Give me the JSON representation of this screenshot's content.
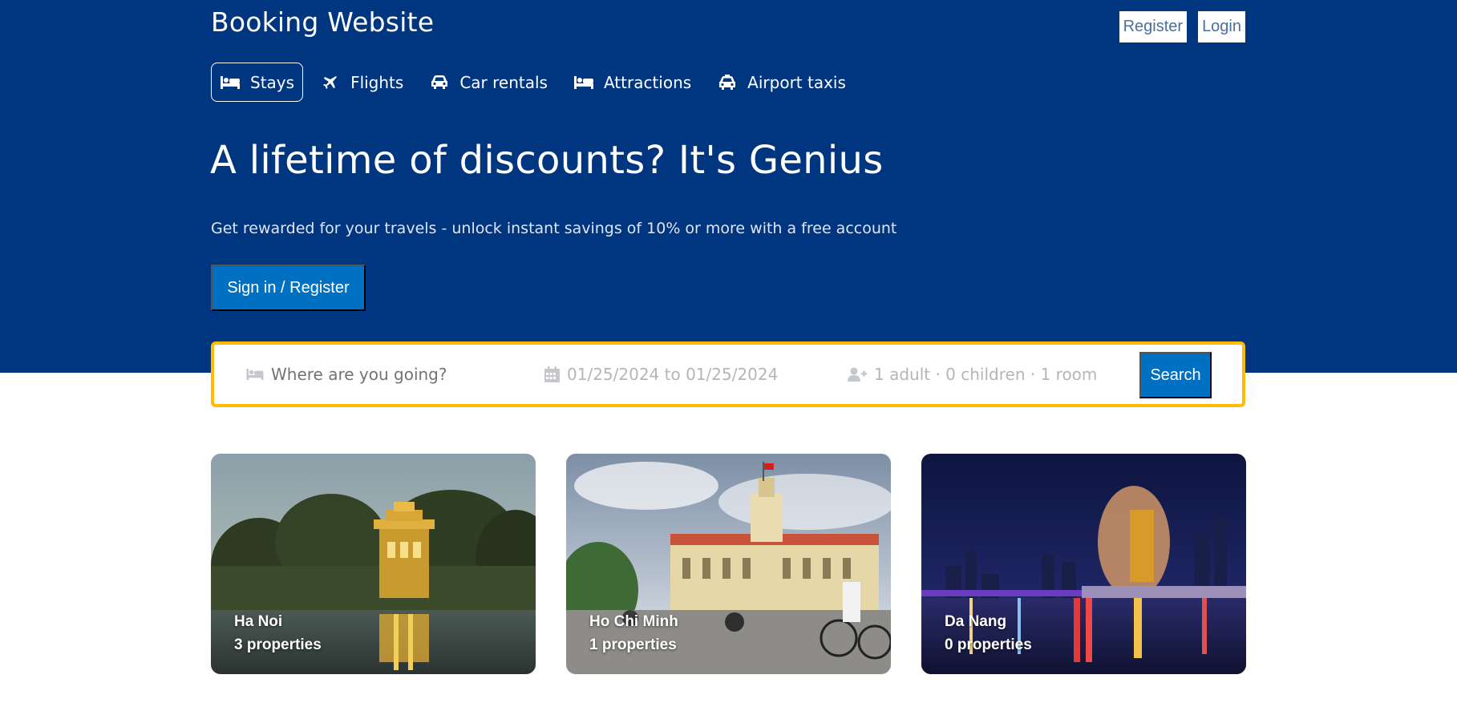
{
  "header": {
    "brand": "Booking Website",
    "register_label": "Register",
    "login_label": "Login"
  },
  "nav": {
    "items": [
      {
        "label": "Stays",
        "icon": "bed-icon",
        "active": true
      },
      {
        "label": "Flights",
        "icon": "plane-icon",
        "active": false
      },
      {
        "label": "Car rentals",
        "icon": "car-icon",
        "active": false
      },
      {
        "label": "Attractions",
        "icon": "bed-icon",
        "active": false
      },
      {
        "label": "Airport taxis",
        "icon": "taxi-icon",
        "active": false
      }
    ]
  },
  "hero": {
    "headline": "A lifetime of discounts? It's Genius",
    "subline": "Get rewarded for your travels - unlock instant savings of 10% or more with a free account",
    "signin_label": "Sign in / Register"
  },
  "search": {
    "destination_placeholder": "Where are you going?",
    "dates": "01/25/2024 to 01/25/2024",
    "guests": "1 adult · 0 children · 1 room",
    "button_label": "Search"
  },
  "cities": [
    {
      "name": "Ha Noi",
      "count": "3 properties"
    },
    {
      "name": "Ho Chi Minh",
      "count": "1 properties"
    },
    {
      "name": "Da Nang",
      "count": "0 properties"
    }
  ],
  "colors": {
    "brand_blue": "#003580",
    "button_blue": "#0071c2",
    "search_border": "#febb02"
  }
}
